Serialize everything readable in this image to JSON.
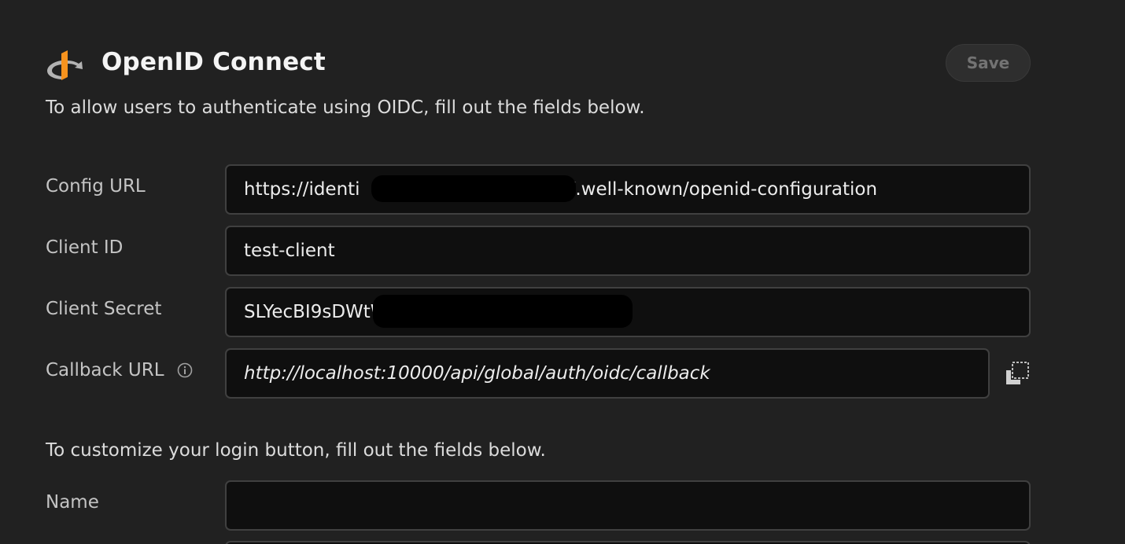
{
  "header": {
    "title": "OpenID Connect",
    "save_label": "Save",
    "logo_icon": "openid-logo-icon"
  },
  "intro_text": "To allow users to authenticate using OIDC, fill out the fields below.",
  "fields": {
    "config_url": {
      "label": "Config URL",
      "value_start": "https://identi",
      "value_end": "/.well-known/openid-configuration"
    },
    "client_id": {
      "label": "Client ID",
      "value": "test-client"
    },
    "client_secret": {
      "label": "Client Secret",
      "value": "SLYecBI9sDWtWc2"
    },
    "callback_url": {
      "label": "Callback URL",
      "value": "http://localhost:10000/api/global/auth/oidc/callback",
      "info_icon": "info-icon",
      "copy_icon": "copy-icon"
    }
  },
  "customize_text": "To customize your login button, fill out the fields below.",
  "customize_fields": {
    "name": {
      "label": "Name",
      "value": ""
    }
  },
  "colors": {
    "background": "#212121",
    "field_background": "#0f0f0f",
    "field_border": "#404040",
    "logo_orange": "#f7931e",
    "logo_gray": "#b3b3b3"
  }
}
